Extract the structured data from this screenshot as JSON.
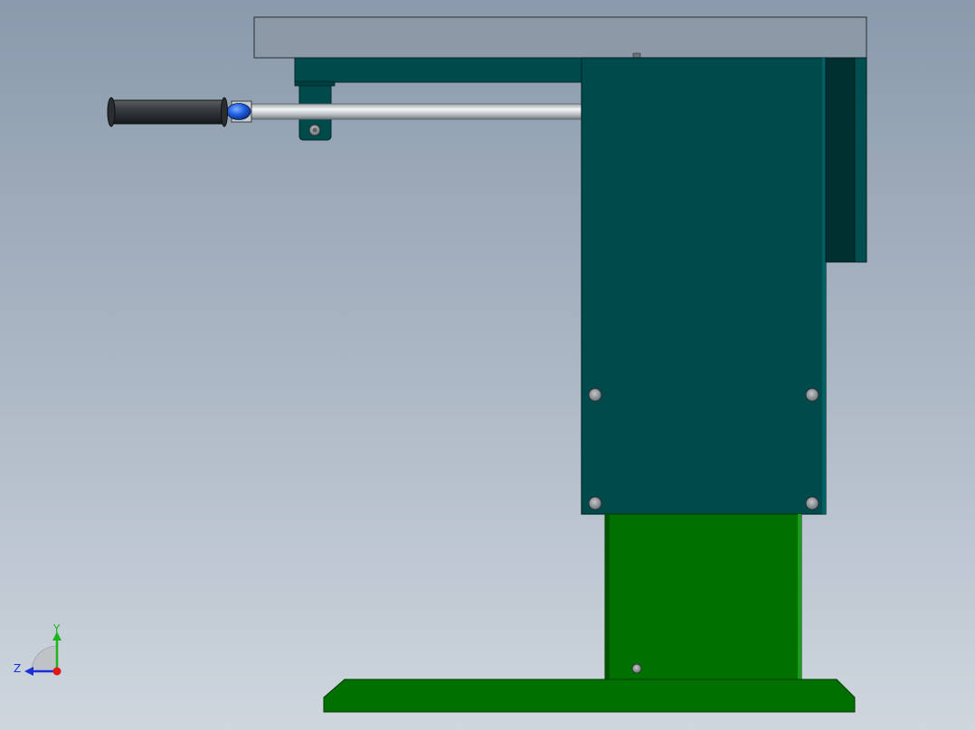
{
  "viewport": {
    "colors": {
      "top_plate": "#8c9aa8",
      "body_teal": "#004a4c",
      "body_edge": "#003537",
      "back_strip": "#002f2f",
      "pedestal": "#007000",
      "pedestal_edge": "#005a00",
      "base_plate": "#007000",
      "rod": "#d8dcdf",
      "grip": "#2f3336",
      "knob": "#1f5fe0",
      "bolt": "#8d9396"
    }
  },
  "triad": {
    "y_label": "Y",
    "z_label": "Z",
    "colors": {
      "y": "#1db51d",
      "z": "#1a2fd8",
      "x": "#e01818"
    }
  }
}
